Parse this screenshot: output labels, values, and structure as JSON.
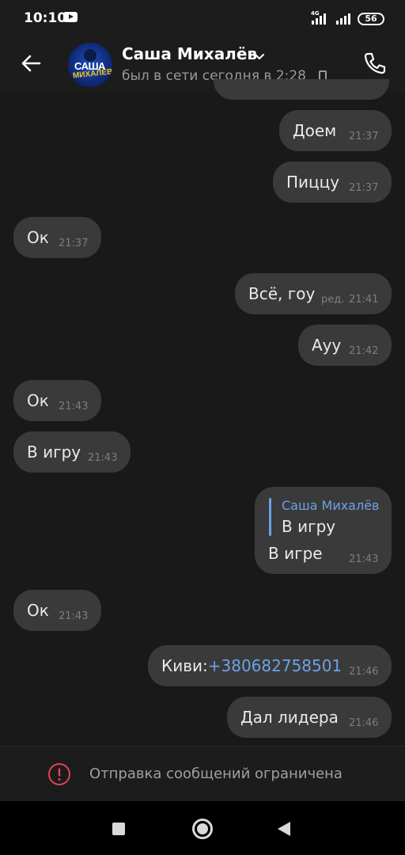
{
  "status_bar": {
    "time": "10:10",
    "network": "4G",
    "battery": "56"
  },
  "header": {
    "contact_name": "Саша Михалёв",
    "contact_status": "был в сети сегодня в 2:28",
    "avatar_text_1": "САША",
    "avatar_text_2": "МИХАЛЁВ"
  },
  "messages": [
    {
      "side": "out",
      "text": "Доем",
      "time": "21:37"
    },
    {
      "side": "out",
      "text": "Пиццу",
      "time": "21:37"
    },
    {
      "side": "in",
      "text": "Ок",
      "time": "21:37"
    },
    {
      "side": "out",
      "text": "Всё, гоу",
      "edited": "ред.",
      "time": "21:41"
    },
    {
      "side": "out",
      "text": "Ауу",
      "time": "21:42"
    },
    {
      "side": "in",
      "text": "Ок",
      "time": "21:43"
    },
    {
      "side": "in",
      "text": "В игру",
      "time": "21:43"
    },
    {
      "side": "out",
      "reply_author": "Саша Михалёв",
      "reply_text": "В игру",
      "text": "В игре",
      "time": "21:43"
    },
    {
      "side": "in",
      "text": "Ок",
      "time": "21:43"
    },
    {
      "side": "out",
      "text_prefix": "Киви:",
      "link": "+380682758501",
      "time": "21:46"
    },
    {
      "side": "out",
      "text": "Дал лидера",
      "time": "21:46"
    }
  ],
  "restriction": {
    "text": "Отправка сообщений ограничена",
    "icon": "alert-circle-icon",
    "icon_color": "#e0454f"
  },
  "colors": {
    "background": "#191919",
    "bubble": "#3a3a3a",
    "link": "#6aa2e6"
  }
}
